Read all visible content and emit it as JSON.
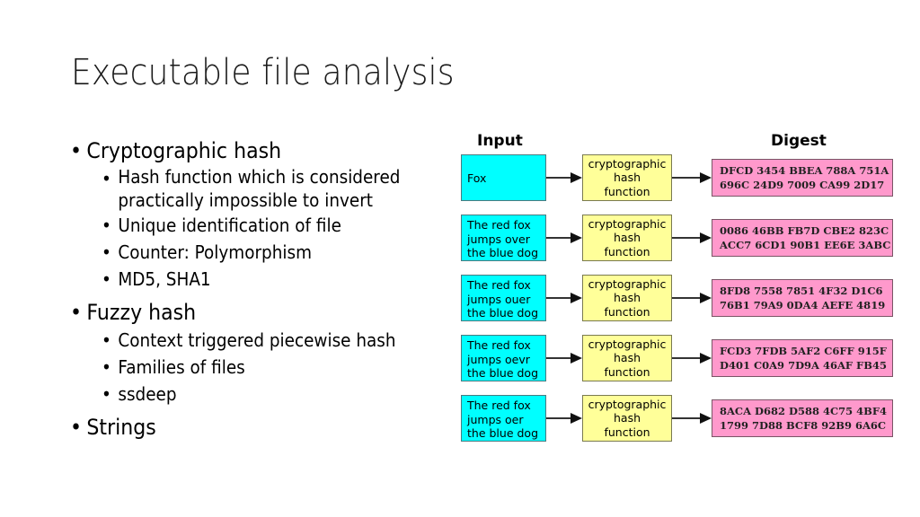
{
  "slide": {
    "title": "Executable file analysis",
    "bullets": [
      {
        "text": "Cryptographic hash",
        "children": [
          {
            "line1": "Hash function which is considered",
            "line2": "practically impossible to invert"
          },
          {
            "line1": "Unique identification of file"
          },
          {
            "line1": "Counter: Polymorphism"
          },
          {
            "line1": "MD5, SHA1"
          }
        ]
      },
      {
        "text": "Fuzzy hash",
        "children": [
          {
            "line1": "Context triggered piecewise hash"
          },
          {
            "line1": "Families of files"
          },
          {
            "line1": "ssdeep"
          }
        ]
      },
      {
        "text": "Strings",
        "children": []
      }
    ],
    "bullet_glyph": "•"
  },
  "diagram": {
    "input_header": "Input",
    "digest_header": "Digest",
    "colors": {
      "input": "#00ffff",
      "function": "#ffff99",
      "digest": "#ff99cc"
    },
    "rows": [
      {
        "input": [
          "Fox"
        ],
        "function": [
          "cryptographic",
          "hash",
          "function"
        ],
        "digest": [
          "DFCD 3454 BBEA 788A 751A",
          "696C 24D9 7009 CA99 2D17"
        ]
      },
      {
        "input": [
          "The red fox",
          "jumps over",
          "the blue dog"
        ],
        "function": [
          "cryptographic",
          "hash",
          "function"
        ],
        "digest": [
          "0086 46BB FB7D CBE2 823C",
          "ACC7 6CD1 90B1 EE6E 3ABC"
        ]
      },
      {
        "input": [
          "The red fox",
          "jumps ouer",
          "the blue dog"
        ],
        "function": [
          "cryptographic",
          "hash",
          "function"
        ],
        "digest": [
          "8FD8 7558 7851 4F32 D1C6",
          "76B1 79A9 0DA4 AEFE 4819"
        ]
      },
      {
        "input": [
          "The red fox",
          "jumps oevr",
          "the blue dog"
        ],
        "function": [
          "cryptographic",
          "hash",
          "function"
        ],
        "digest": [
          "FCD3 7FDB 5AF2 C6FF 915F",
          "D401 C0A9 7D9A 46AF FB45"
        ]
      },
      {
        "input": [
          "The red fox",
          "jumps oer",
          "the blue dog"
        ],
        "function": [
          "cryptographic",
          "hash",
          "function"
        ],
        "digest": [
          "8ACA D682 D588 4C75 4BF4",
          "1799 7D88 BCF8 92B9 6A6C"
        ]
      }
    ]
  }
}
